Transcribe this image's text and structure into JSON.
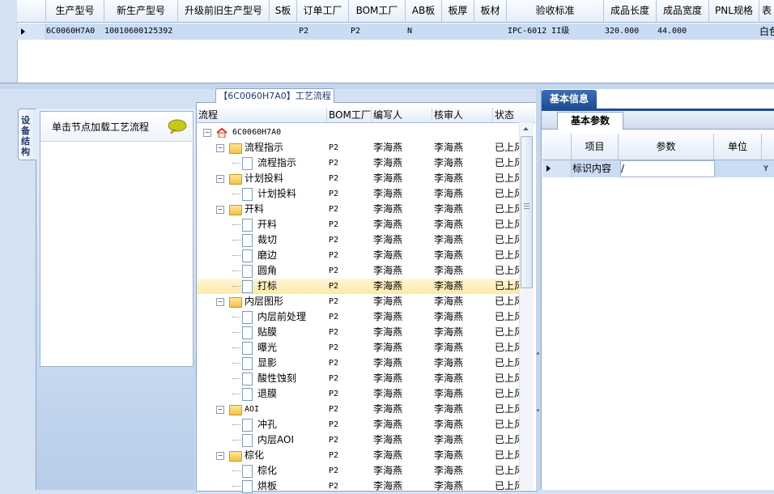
{
  "top_grid": {
    "columns": [
      "生产型号",
      "新生产型号",
      "升级前旧生产型号",
      "S板",
      "订单工厂",
      "BOM工厂",
      "AB板",
      "板厚",
      "板材",
      "验收标准",
      "成品长度",
      "成品宽度",
      "PNL规格",
      "表"
    ],
    "row": [
      "6C0060H7A0",
      "10010600125392",
      "",
      "",
      "P2",
      "P2",
      "N",
      "",
      "",
      "IPC-6012 II级",
      "320.000",
      "44.000",
      "",
      "白色"
    ]
  },
  "left_panel": {
    "vertical_tab": "设备结构",
    "hint": "单击节点加载工艺流程"
  },
  "process_panel": {
    "title": "【6C0060H7A0】工艺流程",
    "columns": [
      "流程",
      "BOM工厂",
      "编写人",
      "核审人",
      "状态"
    ],
    "rows": [
      {
        "name": "6C0060H7A0",
        "factory": "",
        "writer": "",
        "reviewer": "",
        "status": ""
      },
      {
        "name": "流程指示",
        "factory": "P2",
        "writer": "李海燕",
        "reviewer": "李海燕",
        "status": "已上风"
      },
      {
        "name": "流程指示",
        "factory": "P2",
        "writer": "李海燕",
        "reviewer": "李海燕",
        "status": "已上风"
      },
      {
        "name": "计划投料",
        "factory": "P2",
        "writer": "李海燕",
        "reviewer": "李海燕",
        "status": "已上风"
      },
      {
        "name": "计划投料",
        "factory": "P2",
        "writer": "李海燕",
        "reviewer": "李海燕",
        "status": "已上风"
      },
      {
        "name": "开料",
        "factory": "P2",
        "writer": "李海燕",
        "reviewer": "李海燕",
        "status": "已上风"
      },
      {
        "name": "开料",
        "factory": "P2",
        "writer": "李海燕",
        "reviewer": "李海燕",
        "status": "已上风"
      },
      {
        "name": "裁切",
        "factory": "P2",
        "writer": "李海燕",
        "reviewer": "李海燕",
        "status": "已上风"
      },
      {
        "name": "磨边",
        "factory": "P2",
        "writer": "李海燕",
        "reviewer": "李海燕",
        "status": "已上风"
      },
      {
        "name": "圆角",
        "factory": "P2",
        "writer": "李海燕",
        "reviewer": "李海燕",
        "status": "已上风"
      },
      {
        "name": "打标",
        "factory": "P2",
        "writer": "李海燕",
        "reviewer": "李海燕",
        "status": "已上风"
      },
      {
        "name": "内层图形",
        "factory": "P2",
        "writer": "李海燕",
        "reviewer": "李海燕",
        "status": "已上风"
      },
      {
        "name": "内层前处理",
        "factory": "P2",
        "writer": "李海燕",
        "reviewer": "李海燕",
        "status": "已上风"
      },
      {
        "name": "贴膜",
        "factory": "P2",
        "writer": "李海燕",
        "reviewer": "李海燕",
        "status": "已上风"
      },
      {
        "name": "曝光",
        "factory": "P2",
        "writer": "李海燕",
        "reviewer": "李海燕",
        "status": "已上风"
      },
      {
        "name": "显影",
        "factory": "P2",
        "writer": "李海燕",
        "reviewer": "李海燕",
        "status": "已上风"
      },
      {
        "name": "酸性蚀刻",
        "factory": "P2",
        "writer": "李海燕",
        "reviewer": "李海燕",
        "status": "已上风"
      },
      {
        "name": "退膜",
        "factory": "P2",
        "writer": "李海燕",
        "reviewer": "李海燕",
        "status": "已上风"
      },
      {
        "name": "AOI",
        "factory": "P2",
        "writer": "李海燕",
        "reviewer": "李海燕",
        "status": "已上风"
      },
      {
        "name": "冲孔",
        "factory": "P2",
        "writer": "李海燕",
        "reviewer": "李海燕",
        "status": "已上风"
      },
      {
        "name": "内层AOI",
        "factory": "P2",
        "writer": "李海燕",
        "reviewer": "李海燕",
        "status": "已上风"
      },
      {
        "name": "棕化",
        "factory": "P2",
        "writer": "李海燕",
        "reviewer": "李海燕",
        "status": "已上风"
      },
      {
        "name": "棕化",
        "factory": "P2",
        "writer": "李海燕",
        "reviewer": "李海燕",
        "status": "已上风"
      },
      {
        "name": "烘板",
        "factory": "P2",
        "writer": "李海燕",
        "reviewer": "李海燕",
        "status": "已上风"
      }
    ]
  },
  "right_panel": {
    "tab": "基本信息",
    "subtab": "基本参数",
    "columns": [
      "项目",
      "参数",
      "单位"
    ],
    "row": {
      "item": "标识内容",
      "param": "/",
      "unit": "",
      "extra": "Y"
    }
  },
  "colors": {
    "accent": "#1e4d92",
    "selection": "#c9dcf3",
    "highlight": "#fde9a6"
  }
}
